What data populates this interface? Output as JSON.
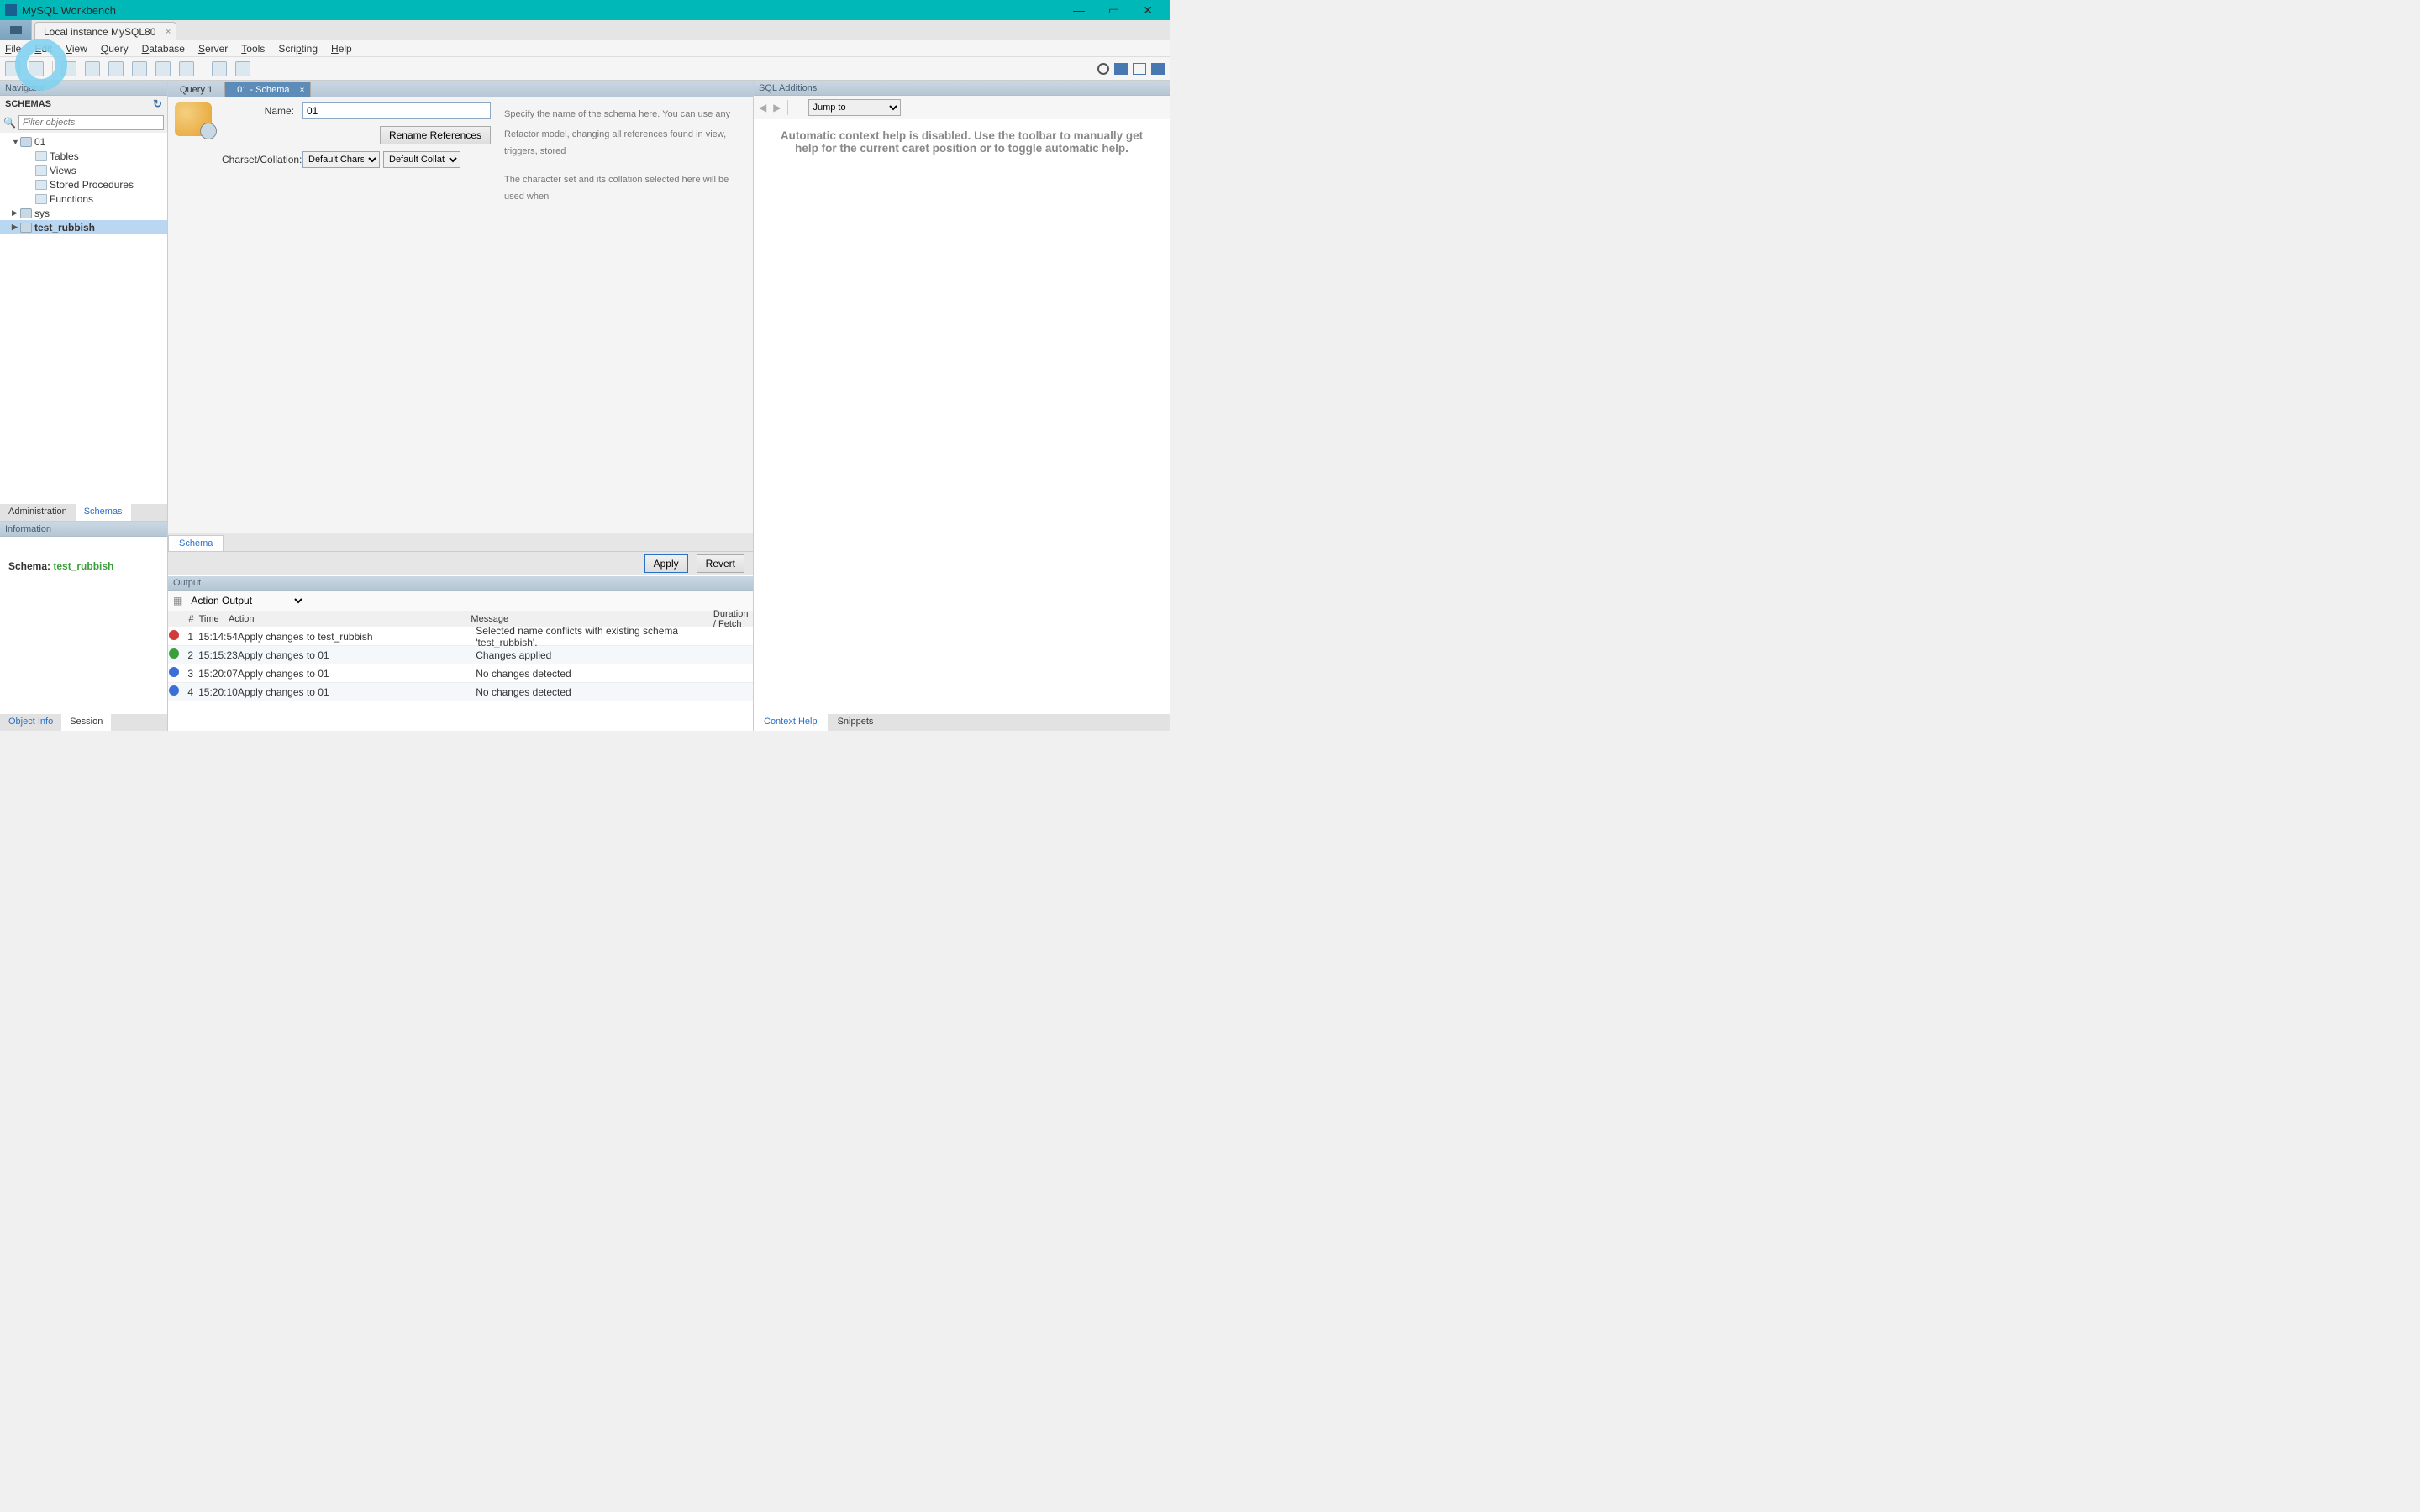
{
  "title": "MySQL Workbench",
  "conntab": "Local instance MySQL80",
  "menus": [
    "File",
    "Edit",
    "View",
    "Query",
    "Database",
    "Server",
    "Tools",
    "Scripting",
    "Help"
  ],
  "nav": {
    "header": "Navigator",
    "schemasLabel": "SCHEMAS",
    "filterPlaceholder": "Filter objects",
    "tree": {
      "db1": "01",
      "db1_children": [
        "Tables",
        "Views",
        "Stored Procedures",
        "Functions"
      ],
      "db2": "sys",
      "db3": "test_rubbish"
    },
    "tabs": {
      "admin": "Administration",
      "schemas": "Schemas"
    }
  },
  "info": {
    "header": "Information",
    "schemaLabel": "Schema:",
    "schemaValue": "test_rubbish",
    "tabs": {
      "obj": "Object Info",
      "sess": "Session"
    }
  },
  "editor": {
    "tabs": {
      "q1": "Query 1",
      "sch": "01 - Schema"
    },
    "form": {
      "nameLabel": "Name:",
      "nameValue": "01",
      "renameBtn": "Rename References",
      "charsetLabel": "Charset/Collation:",
      "charsetValue": "Default Charset",
      "collationValue": "Default Collation",
      "help1": "Specify the name of the schema here. You can use any",
      "help2": "Refactor model, changing all references found in view, triggers, stored",
      "help3": "The character set and its collation selected here will be used when"
    },
    "subtab": "Schema",
    "applyBtn": "Apply",
    "revertBtn": "Revert"
  },
  "output": {
    "header": "Output",
    "selector": "Action Output",
    "cols": {
      "n": "#",
      "t": "Time",
      "a": "Action",
      "m": "Message",
      "d": "Duration / Fetch"
    },
    "rows": [
      {
        "st": "err",
        "n": "1",
        "t": "15:14:54",
        "a": "Apply changes to test_rubbish",
        "m": "Selected name conflicts with existing schema 'test_rubbish'."
      },
      {
        "st": "ok",
        "n": "2",
        "t": "15:15:23",
        "a": "Apply changes to 01",
        "m": "Changes applied"
      },
      {
        "st": "info",
        "n": "3",
        "t": "15:20:07",
        "a": "Apply changes to 01",
        "m": "No changes detected"
      },
      {
        "st": "info",
        "n": "4",
        "t": "15:20:10",
        "a": "Apply changes to 01",
        "m": "No changes detected"
      }
    ]
  },
  "sqladd": {
    "header": "SQL Additions",
    "jumpTo": "Jump to",
    "body": "Automatic context help is disabled. Use the toolbar to manually get help for the current caret position or to toggle automatic help.",
    "tabs": {
      "ctx": "Context Help",
      "snip": "Snippets"
    }
  }
}
